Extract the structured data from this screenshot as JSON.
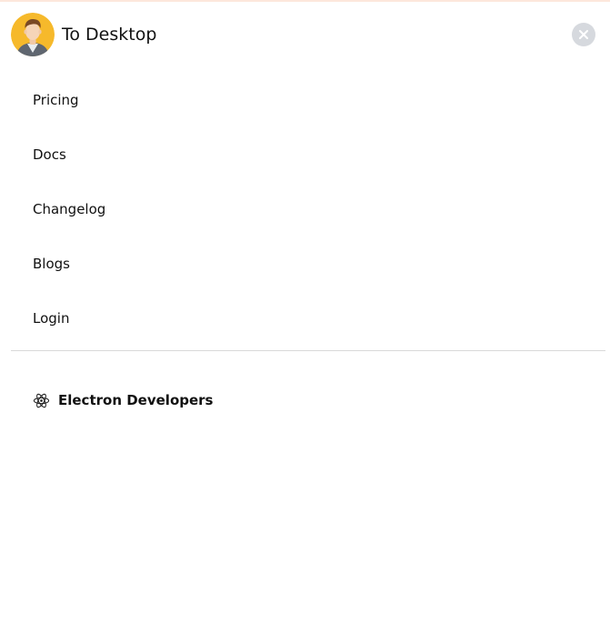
{
  "header": {
    "brand": "To Desktop",
    "avatar_icon": "user-avatar-icon",
    "close_icon": "close-icon"
  },
  "nav": {
    "items": [
      {
        "label": "Pricing"
      },
      {
        "label": "Docs"
      },
      {
        "label": "Changelog"
      },
      {
        "label": "Blogs"
      },
      {
        "label": "Login"
      }
    ]
  },
  "footer": {
    "link_label": "Electron Developers",
    "link_icon": "electron-atom-icon"
  },
  "colors": {
    "close_bg": "#d6d9de",
    "avatar_bg": "#f6b92b",
    "top_accent": "#fde7dc"
  }
}
